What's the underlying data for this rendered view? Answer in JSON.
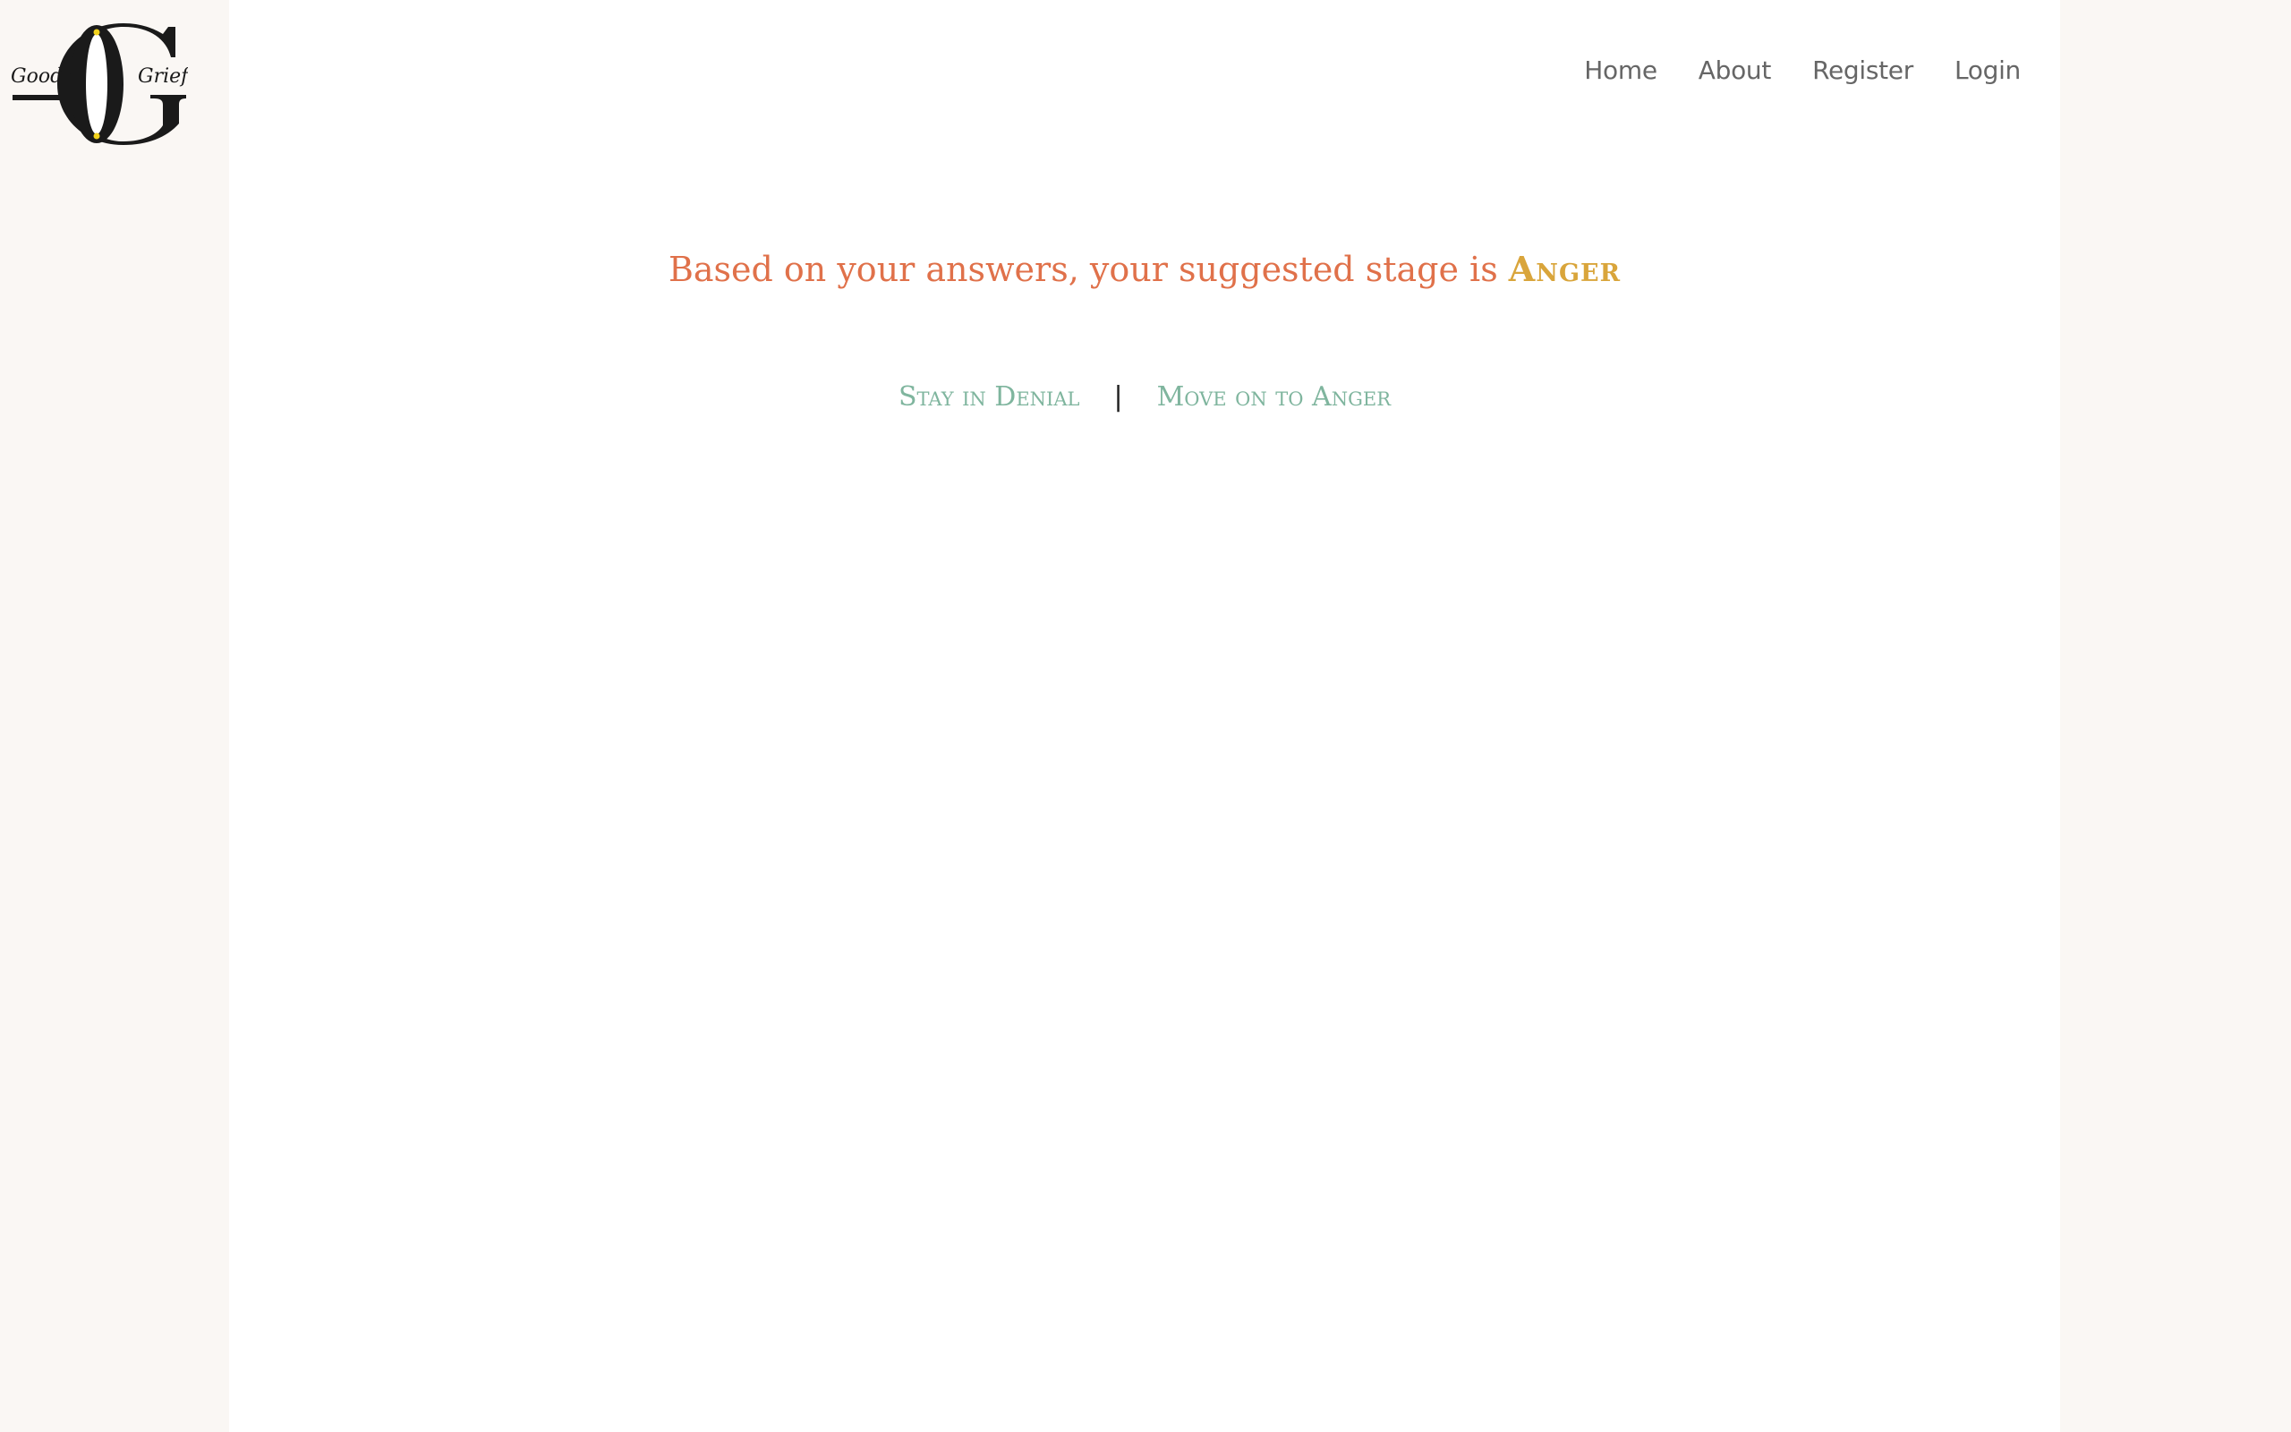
{
  "brand": {
    "logo_word_left": "Good",
    "logo_word_right": "Grief"
  },
  "nav": {
    "items": [
      {
        "label": "Home"
      },
      {
        "label": "About"
      },
      {
        "label": "Register"
      },
      {
        "label": "Login"
      }
    ]
  },
  "result": {
    "prefix": "Based on your answers, your suggested stage is",
    "stage": "Anger"
  },
  "choices": {
    "stay_label": "Stay in Denial",
    "separator": "|",
    "move_label": "Move on to Anger"
  },
  "colors": {
    "page_background": "#faf7f4",
    "panel_background": "#ffffff",
    "nav_text": "#666666",
    "result_text": "#e0714a",
    "stage_text": "#d9a53b",
    "choice_link": "#7fb59e"
  }
}
